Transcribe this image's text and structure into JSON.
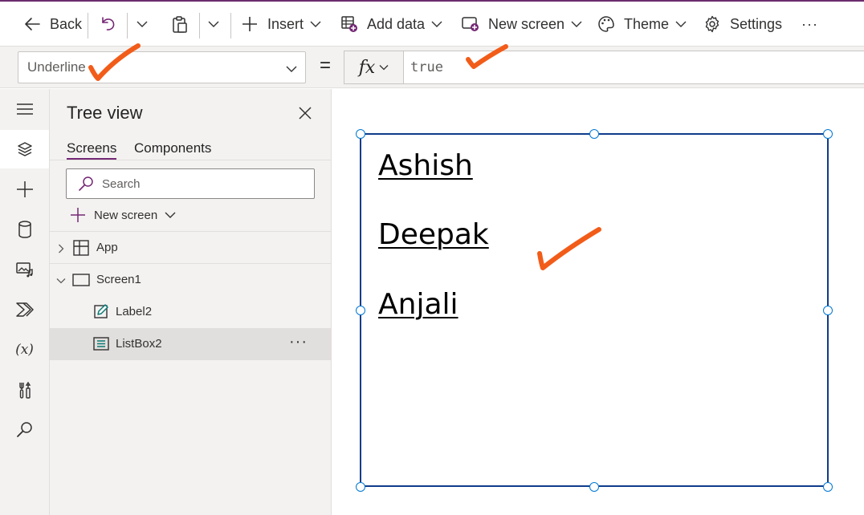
{
  "toolbar": {
    "back_label": "Back",
    "insert_label": "Insert",
    "add_data_label": "Add data",
    "new_screen_label": "New screen",
    "theme_label": "Theme",
    "settings_label": "Settings",
    "more_label": "···"
  },
  "formula_bar": {
    "property": "Underline",
    "equals": "=",
    "fx_label": "fx",
    "formula": "true"
  },
  "tree_view": {
    "title": "Tree view",
    "tabs": [
      "Screens",
      "Components"
    ],
    "active_tab": "Screens",
    "search_placeholder": "Search",
    "new_screen_label": "New screen",
    "nodes": [
      {
        "label": "App",
        "icon": "app-icon",
        "expanded": false
      },
      {
        "label": "Screen1",
        "icon": "screen-icon",
        "expanded": true
      },
      {
        "label": "Label2",
        "icon": "label-edit-icon"
      },
      {
        "label": "ListBox2",
        "icon": "listbox-icon",
        "selected": true
      }
    ],
    "more_label": "···"
  },
  "listbox": {
    "items": [
      "Ashish",
      "Deepak",
      "Anjali"
    ]
  },
  "colors": {
    "accent": "#742774",
    "selection_border": "#0f3c8a",
    "handle_border": "#0078d4",
    "annotation": "#f25c19"
  }
}
